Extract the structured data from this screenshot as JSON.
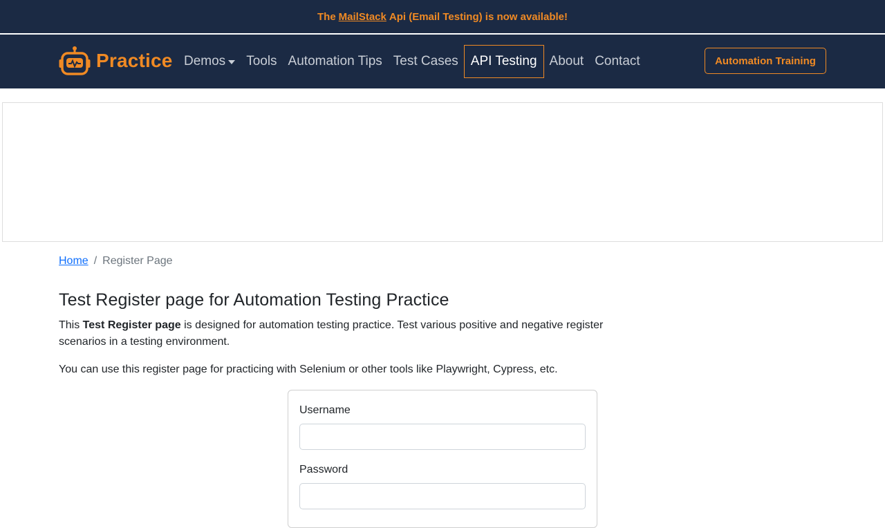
{
  "banner": {
    "prefix": "The",
    "link": "MailStack",
    "suffix": "Api (Email Testing) is now available!"
  },
  "brand": {
    "name": "Practice",
    "icon": "robot-icon"
  },
  "nav": {
    "items": [
      {
        "label": "Demos",
        "dropdown": true
      },
      {
        "label": "Tools"
      },
      {
        "label": "Automation Tips"
      },
      {
        "label": "Test Cases"
      },
      {
        "label": "API Testing",
        "active": true
      },
      {
        "label": "About"
      },
      {
        "label": "Contact"
      }
    ],
    "cta": "Automation Training"
  },
  "breadcrumb": {
    "home": "Home",
    "current": "Register Page"
  },
  "page": {
    "title": "Test Register page for Automation Testing Practice",
    "desc_pre": "This ",
    "desc_bold": "Test Register page",
    "desc_post": " is designed for automation testing practice. Test various positive and negative register scenarios in a testing environment.",
    "desc2": "You can use this register page for practicing with Selenium or other tools like Playwright, Cypress, etc."
  },
  "form": {
    "username_label": "Username",
    "username_value": "",
    "password_label": "Password",
    "password_value": ""
  },
  "colors": {
    "navy": "#1b2a44",
    "accent": "#f08a24",
    "link": "#0d6efd"
  }
}
